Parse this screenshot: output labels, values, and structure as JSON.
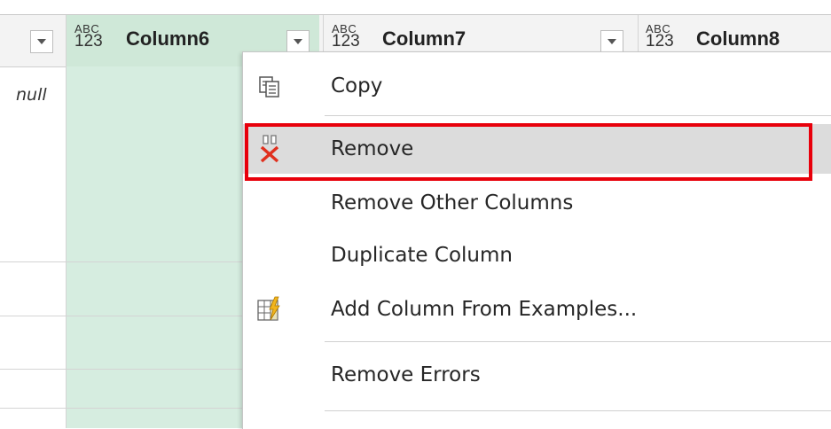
{
  "columns": [
    {
      "name": "Column6",
      "type_top": "ABC",
      "type_bottom": "123",
      "selected": true
    },
    {
      "name": "Column7",
      "type_top": "ABC",
      "type_bottom": "123",
      "selected": false
    },
    {
      "name": "Column8",
      "type_top": "ABC",
      "type_bottom": "123",
      "selected": false
    }
  ],
  "cells": {
    "first_cell": "null"
  },
  "context_menu": {
    "items": [
      {
        "label": "Copy",
        "icon": "copy-icon"
      },
      {
        "label": "Remove",
        "icon": "remove-column-icon",
        "hovered": true
      },
      {
        "label": "Remove Other Columns"
      },
      {
        "label": "Duplicate Column"
      },
      {
        "label": "Add Column From Examples...",
        "icon": "add-column-from-examples-icon"
      },
      {
        "label": "Remove Errors"
      }
    ]
  },
  "colors": {
    "selected_column": "#cfe8d8",
    "highlight": "#e8000b",
    "hover": "#dcdcdc"
  }
}
